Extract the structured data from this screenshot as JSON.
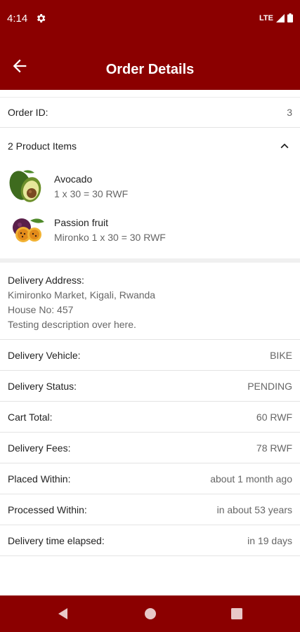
{
  "status_bar": {
    "time": "4:14",
    "network": "LTE"
  },
  "app_bar": {
    "title": "Order Details"
  },
  "order": {
    "id_label": "Order ID:",
    "id_value": "3"
  },
  "products": {
    "header": "2 Product Items",
    "items": [
      {
        "name": "Avocado",
        "price": "1 x 30 = 30 RWF",
        "icon": "avocado-icon"
      },
      {
        "name": "Passion fruit",
        "price": "Mironko 1 x 30 = 30 RWF",
        "icon": "passion-fruit-icon"
      }
    ]
  },
  "address": {
    "label": "Delivery Address:",
    "line1": "Kimironko Market, Kigali, Rwanda",
    "line2": "House No: 457",
    "line3": "Testing description over here."
  },
  "details": [
    {
      "label": "Delivery Vehicle:",
      "value": "BIKE"
    },
    {
      "label": "Delivery Status:",
      "value": "PENDING"
    },
    {
      "label": "Cart Total:",
      "value": "60 RWF"
    },
    {
      "label": "Delivery Fees:",
      "value": "78 RWF"
    },
    {
      "label": "Placed Within:",
      "value": "about 1 month ago"
    },
    {
      "label": "Processed Within:",
      "value": "in about 53 years"
    },
    {
      "label": "Delivery time elapsed:",
      "value": "in 19 days"
    }
  ],
  "colors": {
    "primary": "#8b0000",
    "divider": "#e4e4e4",
    "secondary_text": "#666666"
  },
  "nav": {
    "back": "back-triangle-icon",
    "home": "home-circle-icon",
    "recents": "recents-square-icon"
  }
}
